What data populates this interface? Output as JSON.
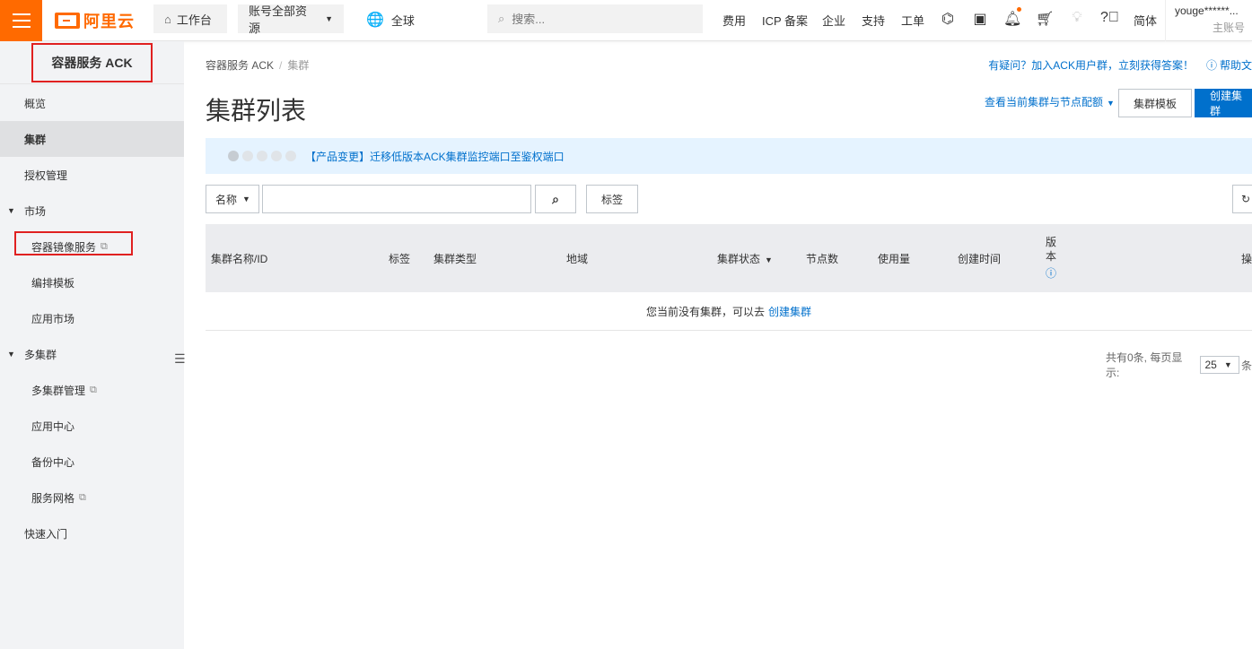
{
  "topbar": {
    "logo_text": "阿里云",
    "workbench": "工作台",
    "resources": "账号全部资源",
    "region": "全球",
    "search_placeholder": "搜索...",
    "nav": [
      "费用",
      "ICP 备案",
      "企业",
      "支持",
      "工单"
    ],
    "lang": "简体",
    "user_name": "youge******...",
    "user_role": "主账号"
  },
  "sidebar": {
    "title": "容器服务 ACK",
    "items": [
      {
        "label": "概览"
      },
      {
        "label": "集群"
      },
      {
        "label": "授权管理"
      },
      {
        "label": "市场"
      },
      {
        "label": "容器镜像服务"
      },
      {
        "label": "编排模板"
      },
      {
        "label": "应用市场"
      },
      {
        "label": "多集群"
      },
      {
        "label": "多集群管理"
      },
      {
        "label": "应用中心"
      },
      {
        "label": "备份中心"
      },
      {
        "label": "服务网格"
      },
      {
        "label": "快速入门"
      }
    ]
  },
  "main": {
    "breadcrumb": [
      "容器服务 ACK",
      "集群"
    ],
    "help_question": "有疑问？加入ACK用户群，立刻获得答案！",
    "help_doc": "帮助文",
    "title": "集群列表",
    "quota_link": "查看当前集群与节点配额",
    "template_button": "集群模板",
    "create_button": "创建集群",
    "notice": "【产品变更】迁移低版本ACK集群监控端口至鉴权端口",
    "filter_select": "名称",
    "filter_input_value": "",
    "tag_button": "标签",
    "columns": [
      "集群名称/ID",
      "标签",
      "集群类型",
      "地域",
      "集群状态",
      "节点数",
      "使用量",
      "创建时间",
      "版本",
      "操"
    ],
    "empty_text": "您当前没有集群，可以去",
    "empty_link": "创建集群",
    "pager_text": "共有0条, 每页显示:",
    "page_size": "25",
    "pager_suffix": "条"
  },
  "colors": {
    "brand": "#ff6a00",
    "link": "#0070cc",
    "highlight_box": "#e02020"
  }
}
